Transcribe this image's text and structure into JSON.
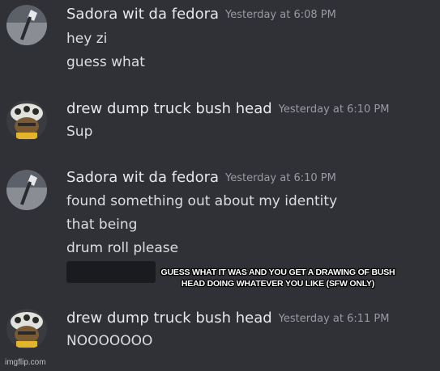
{
  "messages": [
    {
      "author": "Sadora wit da fedora",
      "time": "Yesterday at 6:08 PM",
      "lines": [
        "hey zi",
        "guess what"
      ]
    },
    {
      "author": "drew dump truck bush head",
      "time": "Yesterday at 6:10 PM",
      "lines": [
        "Sup"
      ]
    },
    {
      "author": "Sadora wit da fedora",
      "time": "Yesterday at 6:10 PM",
      "lines": [
        "found something out about my identity",
        "that being",
        "drum roll please"
      ]
    },
    {
      "author": "drew dump truck bush head",
      "time": "Yesterday at 6:11 PM",
      "lines": [
        "NOOOOOOO"
      ]
    }
  ],
  "caption": "GUESS WHAT IT WAS AND YOU GET A DRAWING OF BUSH HEAD DOING WHATEVER YOU LIKE (SFW ONLY)",
  "watermark": "imgflip.com",
  "colors": {
    "background": "#303136",
    "username": "#e8e8ea",
    "timestamp": "#9a9ba2",
    "text": "#dcdde0",
    "spoiler": "#1a1b1f"
  }
}
